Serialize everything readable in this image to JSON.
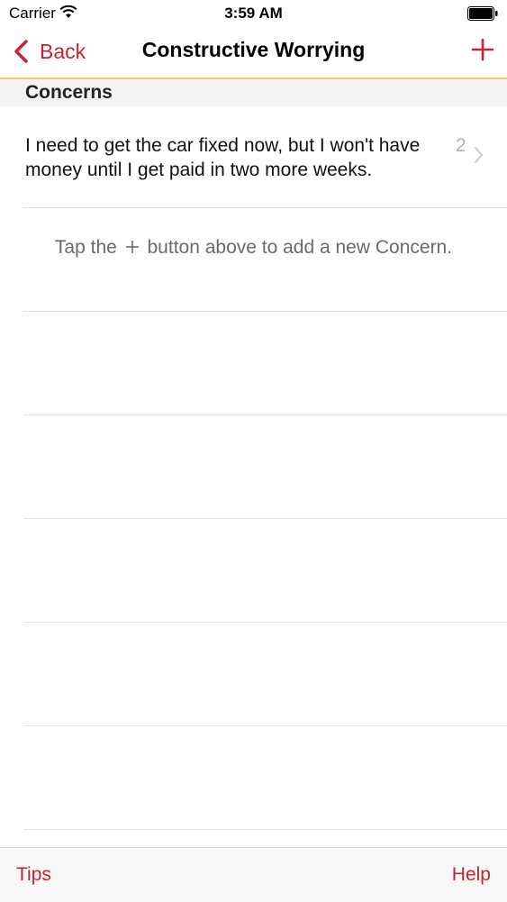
{
  "status_bar": {
    "carrier": "Carrier",
    "time": "3:59 AM"
  },
  "nav": {
    "back_label": "Back",
    "title": "Constructive Worrying",
    "add_icon": "plus-icon"
  },
  "section": {
    "title": "Concerns"
  },
  "concerns": [
    {
      "text": "I need to get the car fixed now, but I won't have money until I get paid in two more weeks.",
      "count": "2"
    }
  ],
  "hint": {
    "prefix": "Tap the",
    "suffix": "button above to add a new Concern."
  },
  "toolbar": {
    "tips_label": "Tips",
    "help_label": "Help"
  },
  "colors": {
    "accent": "#c0262f",
    "nav_divider": "#efc878",
    "section_bg": "#f3f3f3"
  }
}
